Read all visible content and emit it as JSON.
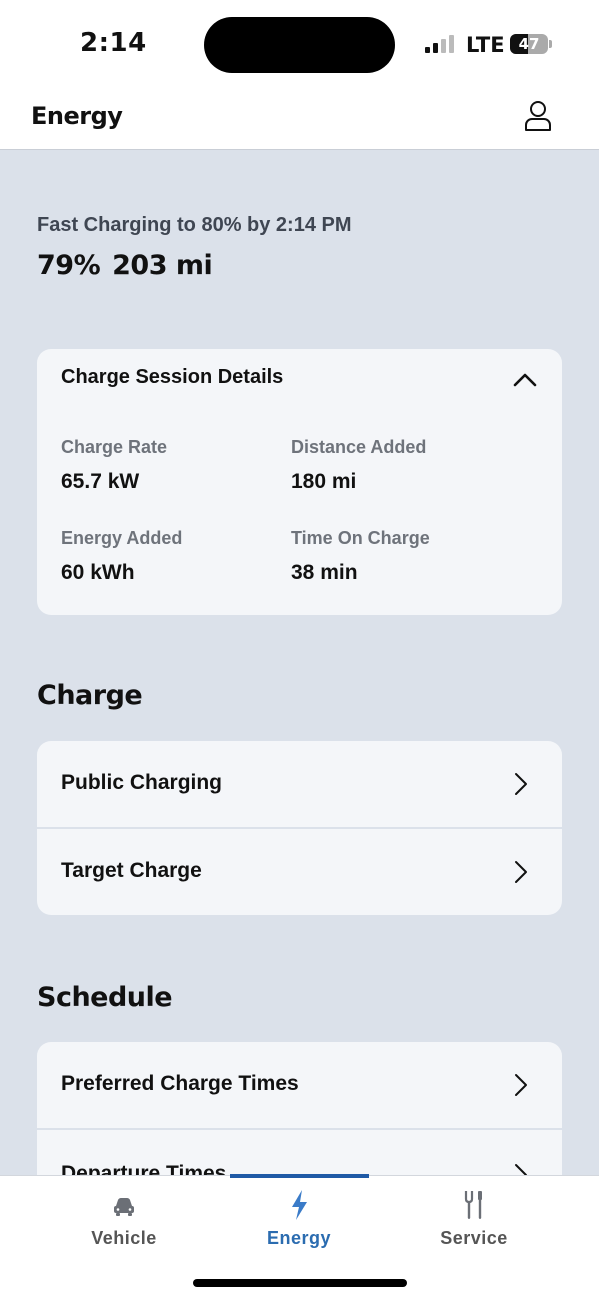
{
  "status_bar": {
    "time": "2:14",
    "network": "LTE",
    "battery_level": "47",
    "battery_fraction": 0.47
  },
  "header": {
    "title": "Energy",
    "profile_icon": "person-icon"
  },
  "charging": {
    "status": "Fast Charging to 80% by 2:14 PM",
    "battery_percent": "79%",
    "range": "203 mi"
  },
  "session_details": {
    "title": "Charge Session Details",
    "toggle_icon": "chevron-up-icon",
    "stats": [
      {
        "label": "Charge Rate",
        "value": "65.7 kW"
      },
      {
        "label": "Distance Added",
        "value": "180 mi"
      },
      {
        "label": "Energy Added",
        "value": "60 kWh"
      },
      {
        "label": "Time On Charge",
        "value": "38 min"
      }
    ]
  },
  "charge_section": {
    "title": "Charge",
    "items": [
      {
        "label": "Public Charging",
        "icon": "chevron-right-icon"
      },
      {
        "label": "Target Charge",
        "icon": "chevron-right-icon"
      }
    ]
  },
  "schedule_section": {
    "title": "Schedule",
    "items": [
      {
        "label": "Preferred Charge Times",
        "icon": "chevron-right-icon"
      },
      {
        "label": "Departure Times",
        "icon": "chevron-right-icon"
      }
    ]
  },
  "bottom_nav": {
    "items": [
      {
        "label": "Vehicle",
        "icon": "car-icon"
      },
      {
        "label": "Energy",
        "icon": "lightning-bolt-icon",
        "active": true
      },
      {
        "label": "Service",
        "icon": "tools-icon"
      }
    ]
  },
  "colors": {
    "page_background": "#dbe1ea",
    "card_background": "#f4f6f9",
    "accent": "#1f5aa6",
    "active_nav_text": "#2b6cb0"
  }
}
